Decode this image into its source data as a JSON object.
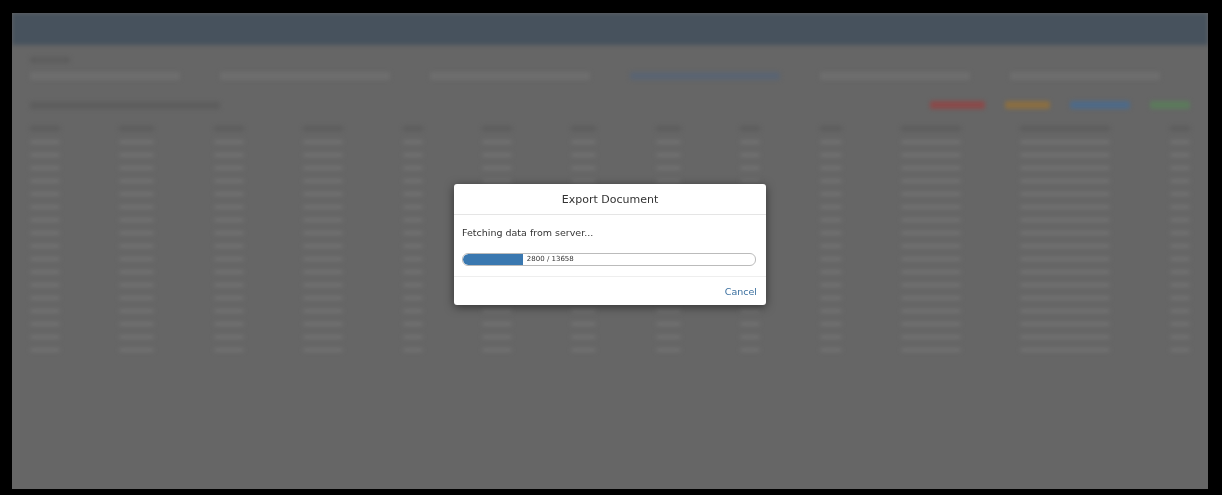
{
  "dialog": {
    "title": "Export Document",
    "message": "Fetching data from server...",
    "progress": {
      "level": 0.205,
      "text": "2800 / 13658"
    },
    "buttons": [
      "Cancel"
    ]
  }
}
